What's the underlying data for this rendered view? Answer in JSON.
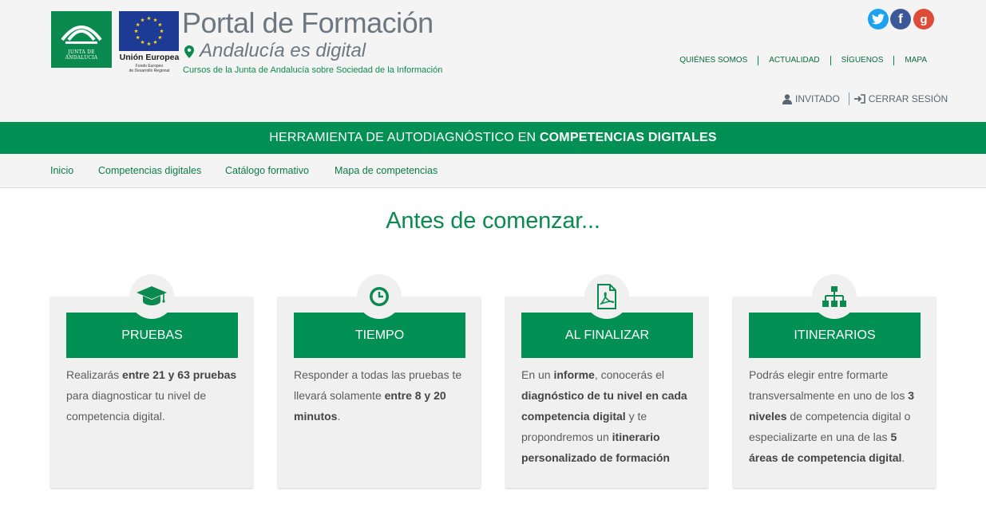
{
  "header": {
    "junta_label": "JUNTA DE ANDALUCIA",
    "eu_title": "Unión Europea",
    "eu_sub_line1": "Fondo Europeo",
    "eu_sub_line2": "de Desarrollo Regional",
    "title": "Portal de Formación",
    "subtitle": "Andalucía es digital",
    "tagline": "Cursos de la Junta de Andalucía sobre Sociedad de la Información",
    "social": {
      "twitter": "t",
      "facebook": "f",
      "google": "g"
    },
    "top_menu": [
      "QUIÉNES SOMOS",
      "ACTUALIDAD",
      "SÍGUENOS",
      "MAPA"
    ],
    "user_label": "INVITADO",
    "logout_label": "CERRAR SESIÓN"
  },
  "banner": {
    "prefix": "HERRAMIENTA DE AUTODIAGNÓSTICO EN ",
    "bold": "COMPETENCIAS DIGITALES"
  },
  "nav": [
    "Inicio",
    "Competencias digitales",
    "Catálogo formativo",
    "Mapa de competencias"
  ],
  "main": {
    "heading": "Antes de comenzar...",
    "cards": [
      {
        "title": "PRUEBAS",
        "icon": "graduation-cap-icon",
        "text": [
          {
            "t": "Realizarás "
          },
          {
            "t": "entre 21 y 63 pruebas",
            "b": true
          },
          {
            "t": " para diagnosticar tu nivel de competencia digital."
          }
        ]
      },
      {
        "title": "TIEMPO",
        "icon": "clock-icon",
        "text": [
          {
            "t": "Responder a todas las pruebas te llevará solamente "
          },
          {
            "t": "entre 8 y 20 minutos",
            "b": true
          },
          {
            "t": "."
          }
        ]
      },
      {
        "title": "AL FINALIZAR",
        "icon": "pdf-file-icon",
        "text": [
          {
            "t": "En un "
          },
          {
            "t": "informe",
            "b": true
          },
          {
            "t": ", conocerás el "
          },
          {
            "t": "diagnóstico de tu nivel en cada competencia digital",
            "b": true
          },
          {
            "t": " y te propondremos un "
          },
          {
            "t": "itinerario personalizado de formación",
            "b": true
          }
        ]
      },
      {
        "title": "ITINERARIOS",
        "icon": "sitemap-icon",
        "text": [
          {
            "t": "Podrás elegir entre formarte transversalmente en uno de los "
          },
          {
            "t": "3 niveles",
            "b": true
          },
          {
            "t": " de competencia digital o especializarte en una de las "
          },
          {
            "t": "5 áreas de competencia digital",
            "b": true
          },
          {
            "t": "."
          }
        ]
      }
    ]
  },
  "colors": {
    "brand_green": "#009053",
    "text_green": "#0b8a4f",
    "gray_bg": "#f4f4f5"
  }
}
